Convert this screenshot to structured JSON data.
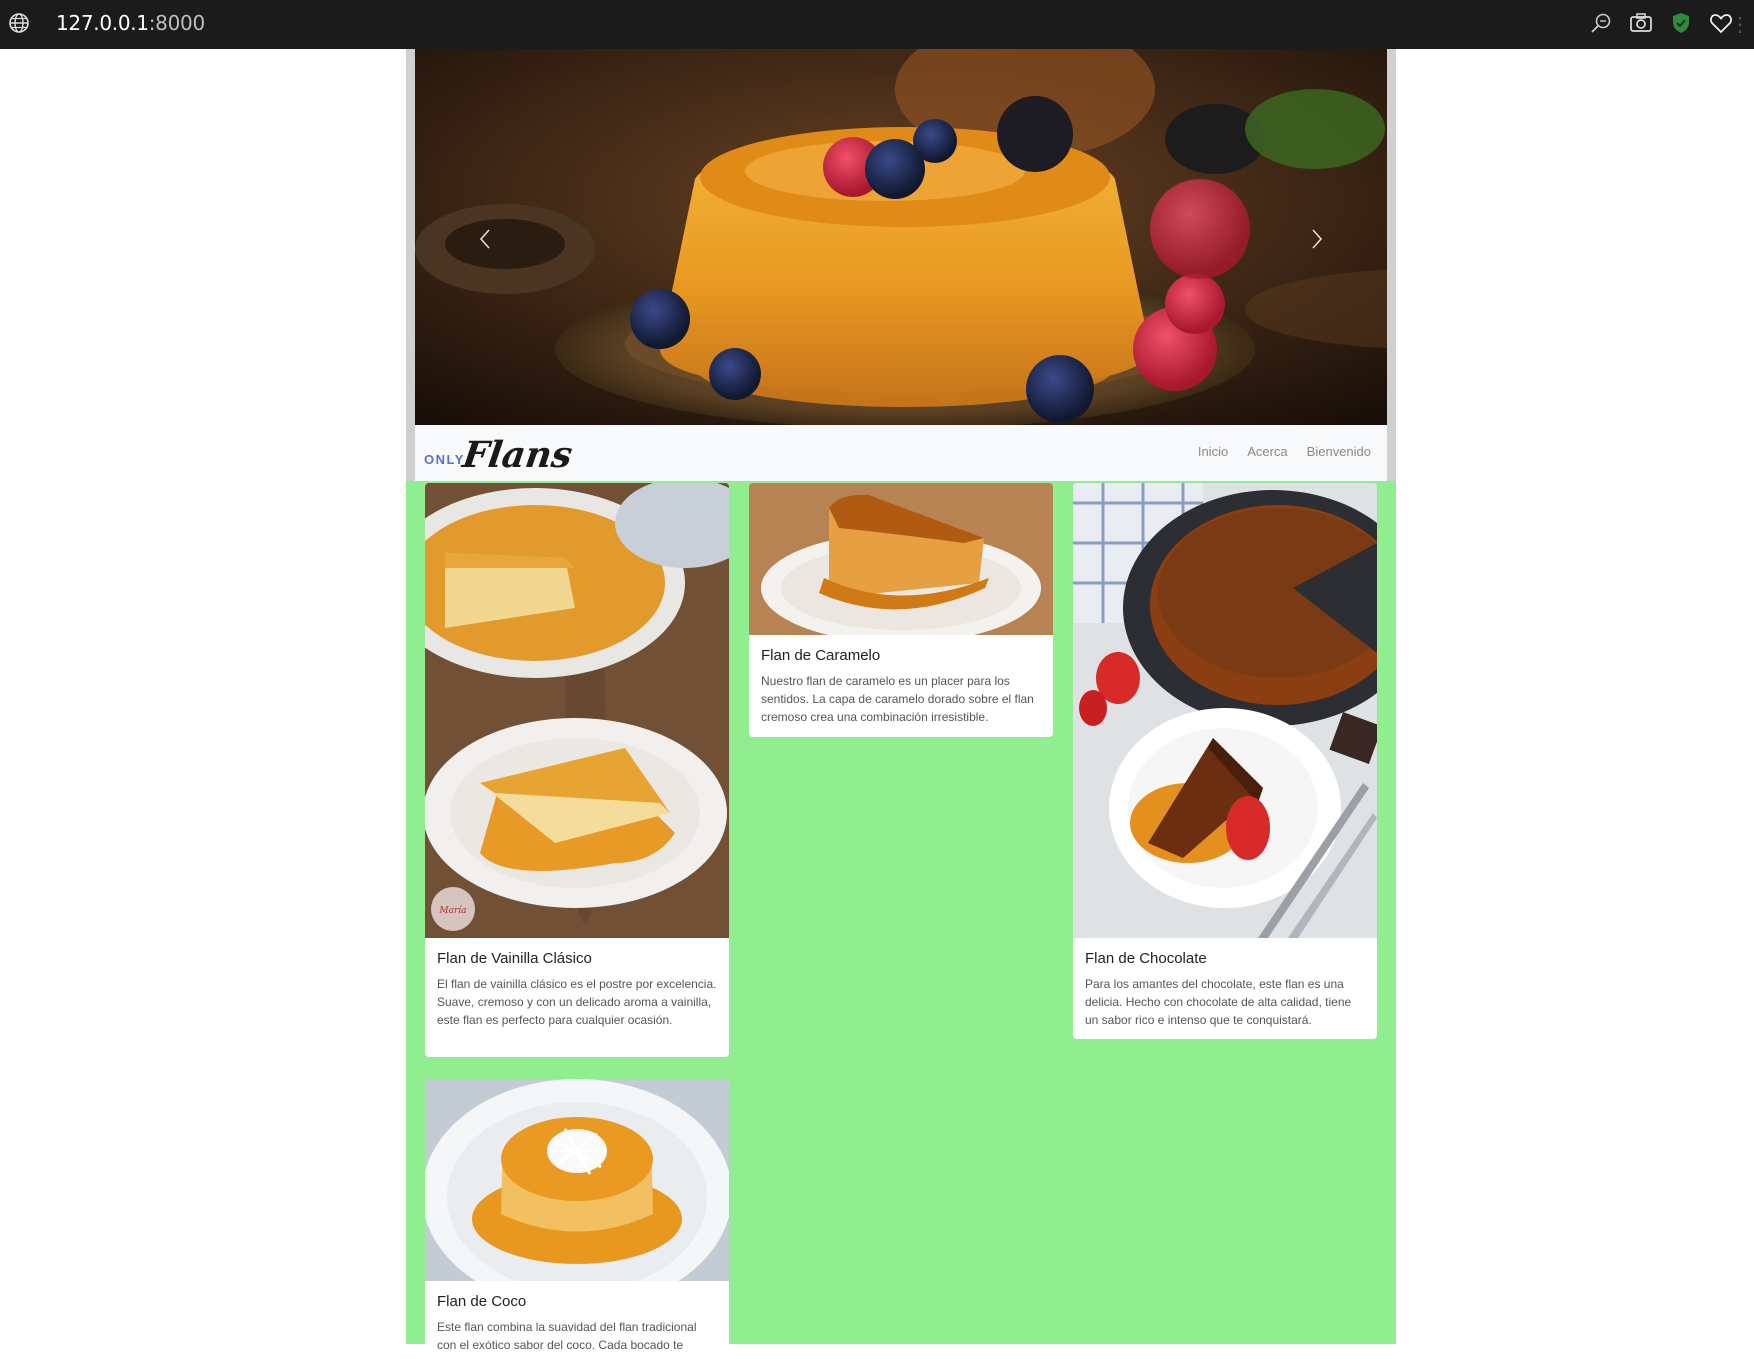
{
  "browser": {
    "url_host": "127.0.0.1",
    "url_port": ":8000"
  },
  "hero": {
    "prev_label": "‹",
    "next_label": "›"
  },
  "navbar": {
    "brand_small": "ONLY",
    "brand_large": "Flans",
    "links": [
      {
        "label": "Inicio"
      },
      {
        "label": "Acerca"
      },
      {
        "label": "Bienvenido"
      }
    ]
  },
  "cards": [
    {
      "title": "Flan de Vainilla Clásico",
      "text": "El flan de vainilla clásico es el postre por excelencia. Suave, cremoso y con un delicado aroma a vainilla, este flan es perfecto para cualquier ocasión."
    },
    {
      "title": "Flan de Caramelo",
      "text": "Nuestro flan de caramelo es un placer para los sentidos. La capa de caramelo dorado sobre el flan cremoso crea una combinación irresistible."
    },
    {
      "title": "Flan de Chocolate",
      "text": "Para los amantes del chocolate, este flan es una delicia. Hecho con chocolate de alta calidad, tiene un sabor rico e intenso que te conquistará."
    },
    {
      "title": "Flan de Coco",
      "text": "Este flan combina la suavidad del flan tradicional con el exótico sabor del coco. Cada bocado te"
    }
  ],
  "colors": {
    "page_bg": "#90ee90",
    "browser_bar": "#1b1b1b",
    "brand_accent": "#5a6fd8"
  }
}
